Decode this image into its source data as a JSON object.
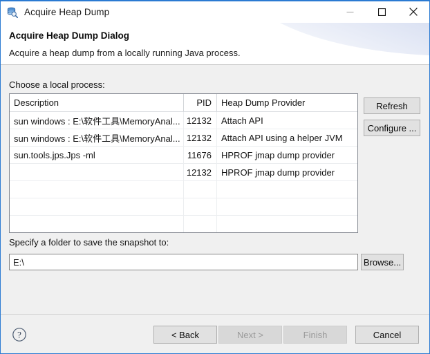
{
  "window": {
    "title": "Acquire Heap Dump",
    "app_icon": "database-search-icon",
    "controls": {
      "minimize": "minimize-icon",
      "maximize": "maximize-icon",
      "close": "close-icon"
    }
  },
  "header": {
    "title": "Acquire Heap Dump Dialog",
    "description": "Acquire a heap dump from a locally running Java process."
  },
  "main": {
    "choose_label": "Choose a local process:",
    "table": {
      "columns": [
        "Description",
        "PID",
        "Heap Dump Provider"
      ],
      "rows": [
        {
          "description": "sun windows : E:\\软件工具\\MemoryAnal...",
          "pid": "12132",
          "provider": "Attach API"
        },
        {
          "description": "sun windows : E:\\软件工具\\MemoryAnal...",
          "pid": "12132",
          "provider": "Attach API using a helper JVM"
        },
        {
          "description": "sun.tools.jps.Jps -ml",
          "pid": "11676",
          "provider": "HPROF jmap dump provider"
        },
        {
          "description": "",
          "pid": "12132",
          "provider": "HPROF jmap dump provider"
        },
        {
          "description": "",
          "pid": "",
          "provider": ""
        },
        {
          "description": "",
          "pid": "",
          "provider": ""
        },
        {
          "description": "",
          "pid": "",
          "provider": ""
        },
        {
          "description": "",
          "pid": "",
          "provider": ""
        }
      ]
    },
    "side_buttons": {
      "refresh": "Refresh",
      "configure": "Configure ..."
    },
    "folder": {
      "label": "Specify a folder to save the snapshot to:",
      "value": "E:\\",
      "placeholder": "",
      "browse": "Browse..."
    }
  },
  "footer": {
    "help_icon": "help-question-icon",
    "buttons": [
      {
        "label": "< Back",
        "enabled": true
      },
      {
        "label": "Next >",
        "enabled": false
      },
      {
        "label": "Finish",
        "enabled": false
      },
      {
        "label": "Cancel",
        "enabled": true
      }
    ]
  },
  "colors": {
    "window_border": "#2a7ad2",
    "body_background": "#f0f0f0",
    "header_background": "#ffffff",
    "table_background": "#ffffff"
  }
}
